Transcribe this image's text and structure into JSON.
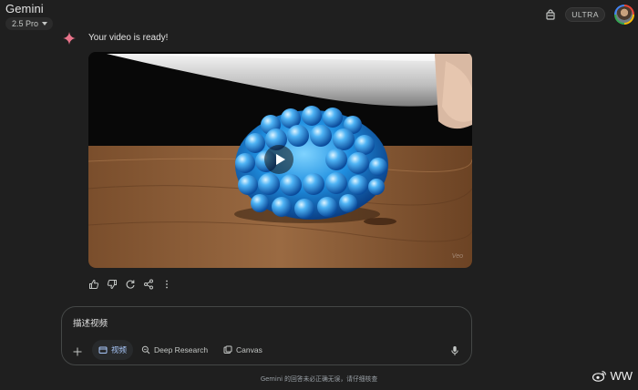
{
  "header": {
    "app_title": "Gemini",
    "model": "2.5 Pro",
    "plan_badge": "ULTRA",
    "icons": [
      "shopping-bag-icon",
      "avatar"
    ]
  },
  "message": {
    "text": "Your video is ready!",
    "icon": "gemini-sparkle-icon",
    "video": {
      "watermark": "Veo",
      "icons": [
        "play-icon"
      ]
    },
    "actions": [
      "thumbs-up-icon",
      "thumbs-down-icon",
      "regenerate-icon",
      "share-icon",
      "more-vert-icon"
    ]
  },
  "composer": {
    "placeholder": "描述视频",
    "chips": {
      "video": "视频",
      "deep_research": "Deep Research",
      "canvas": "Canvas"
    },
    "icons": [
      "add-icon",
      "video-icon",
      "deep-research-icon",
      "canvas-icon",
      "mic-icon"
    ]
  },
  "footer": {
    "disclaimer": "Gemini 的回答未必正确无误，请仔细核查",
    "watermark": "WW"
  },
  "colors": {
    "background": "#1f1f1f",
    "accent": "#a8c7fa",
    "sparkle": "#e8738a"
  }
}
